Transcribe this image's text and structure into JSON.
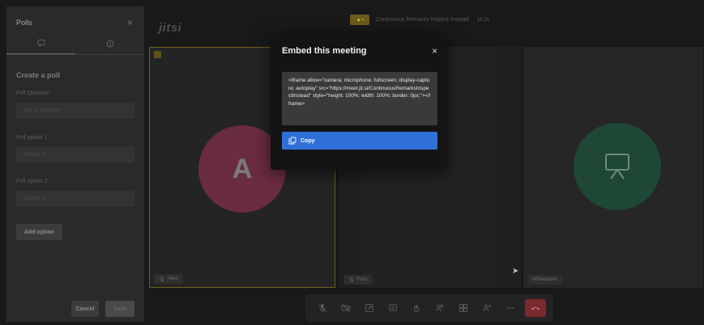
{
  "polls": {
    "title": "Polls",
    "close_glyph": "×",
    "tabs": [
      {
        "icon": "chat-icon",
        "glyph": "💬"
      },
      {
        "icon": "info-icon",
        "glyph": "ⓘ"
      }
    ],
    "section_title": "Create a poll",
    "question_label": "Poll Question",
    "question_placeholder": "Ask a question",
    "options": [
      {
        "label": "Poll option 1",
        "placeholder": "Option 1"
      },
      {
        "label": "Poll option 2",
        "placeholder": "Option 2"
      }
    ],
    "add_option_label": "Add option",
    "cancel_label": "Cancel",
    "save_label": "Save"
  },
  "header": {
    "logo": "jitsi",
    "meeting_name": "Continuous Remarks Inspect Instead",
    "timer": "18:24"
  },
  "tiles": {
    "participant_a": {
      "initial": "A",
      "name": "Allen",
      "avatar_color": "#6a2c3f"
    },
    "participant_b": {
      "name": "Fred"
    },
    "whiteboard": {
      "name": "Whiteboard",
      "color": "#1f4736"
    }
  },
  "modal": {
    "title": "Embed this meeting",
    "close_glyph": "×",
    "code": "<iframe allow=\"camera; microphone; fullscreen; display-capture; autoplay\" src=\"https://meet.jit.si/ContinuousRemarksInspectInstead\" style=\"height: 100%; width: 100%; border: 0px;\"></iframe>",
    "copy_label": "Copy",
    "accent": "#2f6fd8"
  },
  "toolbar": {
    "buttons": [
      "microphone-icon",
      "camera-icon",
      "share-screen-icon",
      "chat-icon",
      "raise-hand-icon",
      "participants-icon",
      "tile-view-icon",
      "invite-icon",
      "more-icon",
      "hangup-icon"
    ]
  }
}
